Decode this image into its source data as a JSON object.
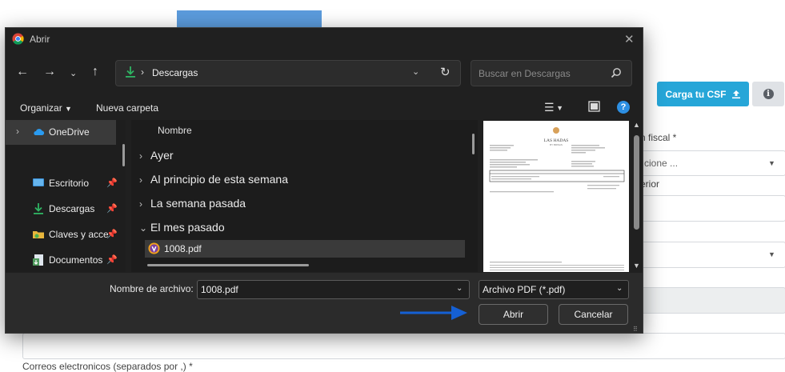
{
  "background": {
    "csf_button": "Carga tu CSF",
    "info_icon": "i",
    "label_regimen": "n fiscal *",
    "select_regimen": "cione ...",
    "label_anterior": "erior",
    "label_correos": "Correos electronicos (separados por ,) *"
  },
  "dialog": {
    "title": "Abrir",
    "address": {
      "folder": "Descargas"
    },
    "search_placeholder": "Buscar en Descargas",
    "toolbar": {
      "organize": "Organizar",
      "new_folder": "Nueva carpeta"
    },
    "nav_items": [
      {
        "label": "OneDrive",
        "icon": "onedrive-icon"
      },
      {
        "label": "Escritorio",
        "icon": "desktop-icon"
      },
      {
        "label": "Descargas",
        "icon": "download-icon"
      },
      {
        "label": "Claves y acceso",
        "icon": "folder-icon"
      },
      {
        "label": "Documentos",
        "icon": "documents-icon"
      }
    ],
    "column_header": "Nombre",
    "groups": [
      "Ayer",
      "Al principio de esta semana",
      "La semana pasada",
      "El mes pasado"
    ],
    "selected_file": "1008.pdf",
    "preview": {
      "brand": "LAS HADAS",
      "brand_sub": "BY BRISAS"
    },
    "filename_label": "Nombre de archivo:",
    "filename_value": "1008.pdf",
    "filetype": "Archivo PDF (*.pdf)",
    "open_button": "Abrir",
    "cancel_button": "Cancelar"
  },
  "colors": {
    "accent": "#26a6d8",
    "dialog_bg": "#202020",
    "arrow": "#1560d4"
  }
}
